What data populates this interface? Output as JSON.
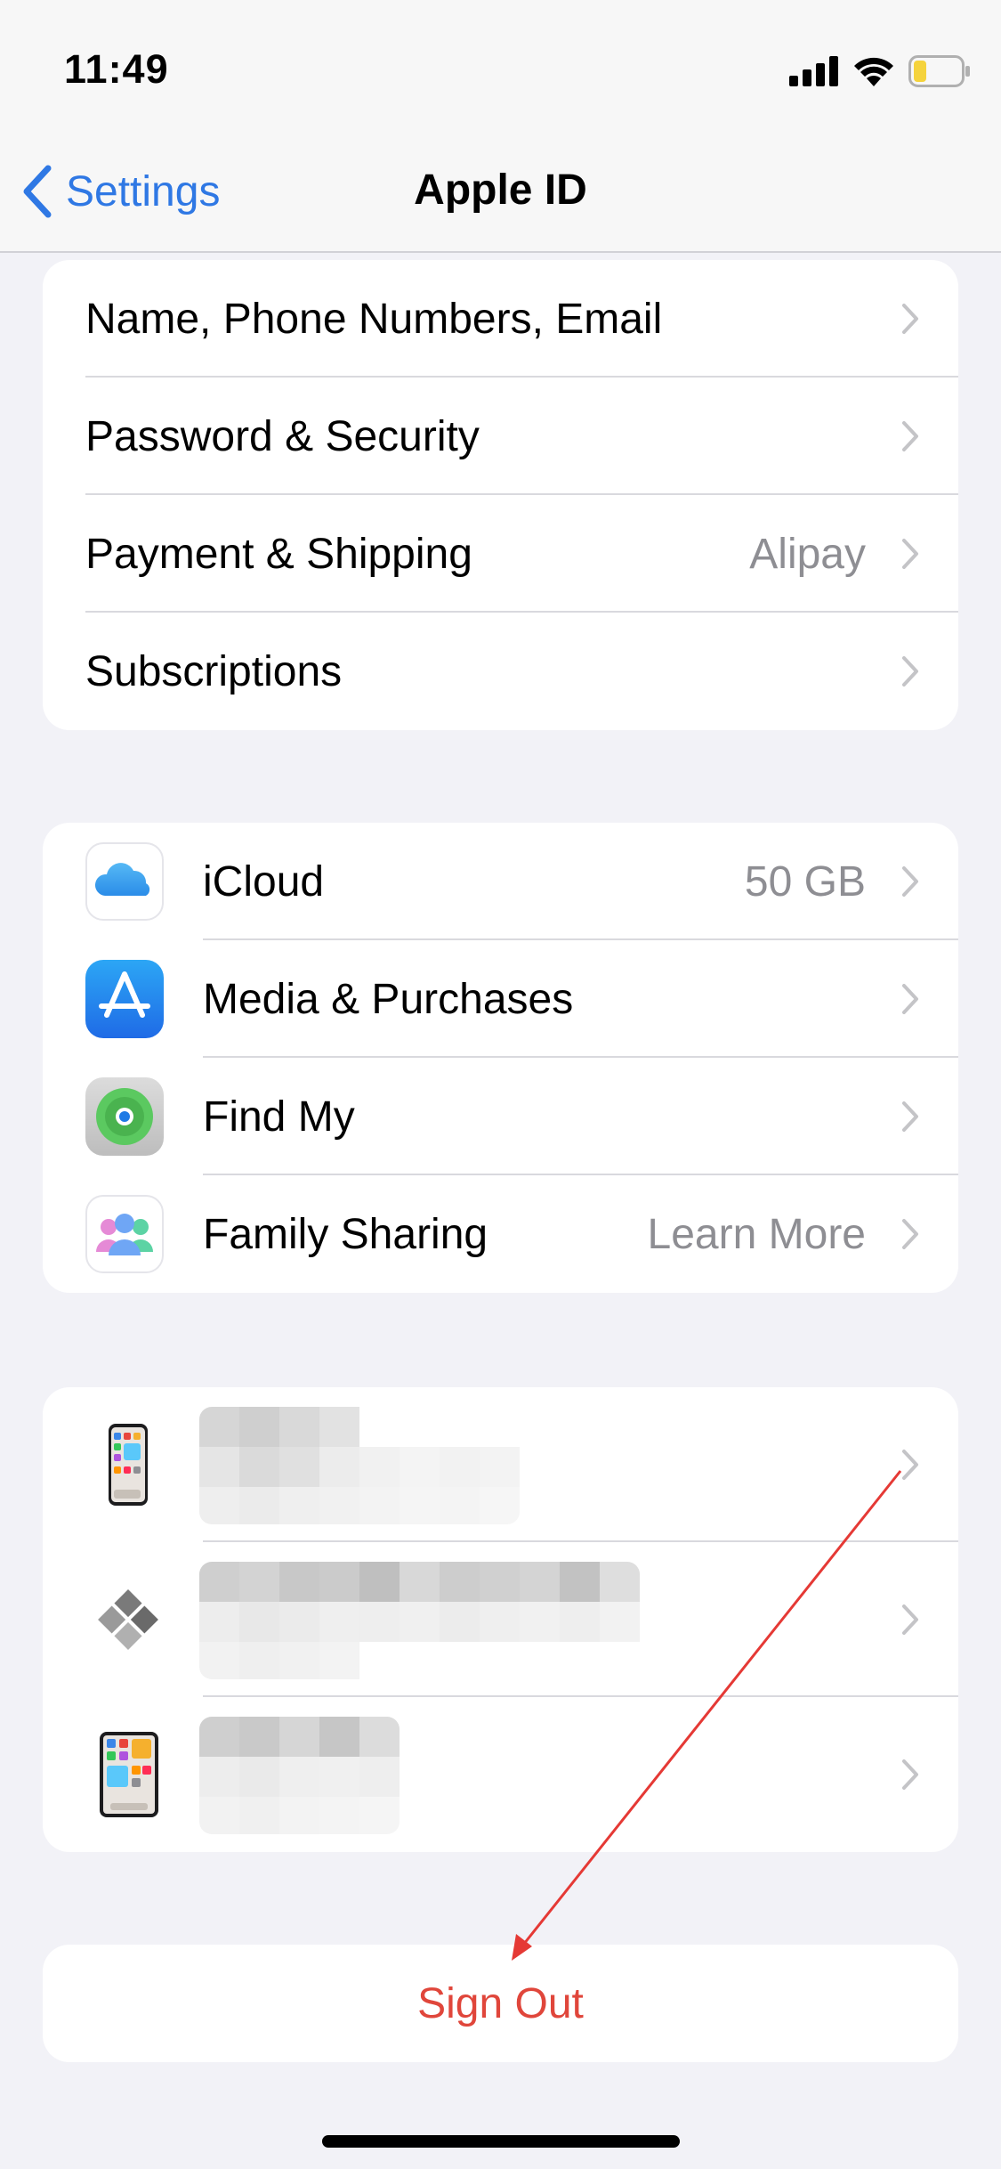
{
  "status_bar": {
    "time": "11:49",
    "icons": [
      "cellular-signal-icon",
      "wifi-icon",
      "battery-icon"
    ],
    "battery_color": "#f5d33c"
  },
  "nav": {
    "back_label": "Settings",
    "title": "Apple ID",
    "accent_color": "#2f78e4"
  },
  "account_group": {
    "items": [
      {
        "label": "Name, Phone Numbers, Email",
        "detail": ""
      },
      {
        "label": "Password & Security",
        "detail": ""
      },
      {
        "label": "Payment & Shipping",
        "detail": "Alipay"
      },
      {
        "label": "Subscriptions",
        "detail": ""
      }
    ]
  },
  "services_group": {
    "items": [
      {
        "label": "iCloud",
        "detail": "50 GB",
        "icon": "icloud-icon"
      },
      {
        "label": "Media & Purchases",
        "detail": "",
        "icon": "app-store-icon"
      },
      {
        "label": "Find My",
        "detail": "",
        "icon": "find-my-icon"
      },
      {
        "label": "Family Sharing",
        "detail": "Learn More",
        "icon": "family-sharing-icon"
      }
    ]
  },
  "devices_group": {
    "items": [
      {
        "icon": "iphone-device-icon",
        "name_obscured": true
      },
      {
        "icon": "windows-pc-device-icon",
        "name_obscured": true
      },
      {
        "icon": "ipad-device-icon",
        "name_obscured": true
      }
    ]
  },
  "sign_out": {
    "label": "Sign Out",
    "color": "#e0463b"
  },
  "annotation": {
    "type": "arrow",
    "color": "#e53935",
    "points_to": "sign-out-button"
  }
}
